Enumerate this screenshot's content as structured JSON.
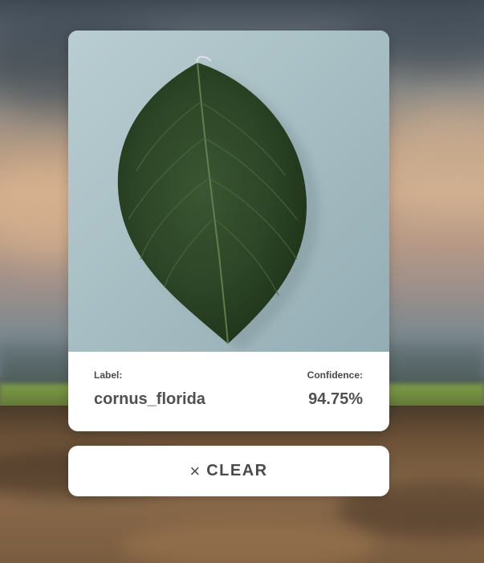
{
  "result": {
    "label_caption": "Label:",
    "label_value": "cornus_florida",
    "confidence_caption": "Confidence:",
    "confidence_value": "94.75%"
  },
  "actions": {
    "clear_icon": "×",
    "clear_label": "CLEAR"
  },
  "icons": {
    "clear": "close-icon"
  },
  "colors": {
    "card_background": "#ffffff",
    "text": "#4a4a4a",
    "leaf": "#2f4a2a"
  }
}
